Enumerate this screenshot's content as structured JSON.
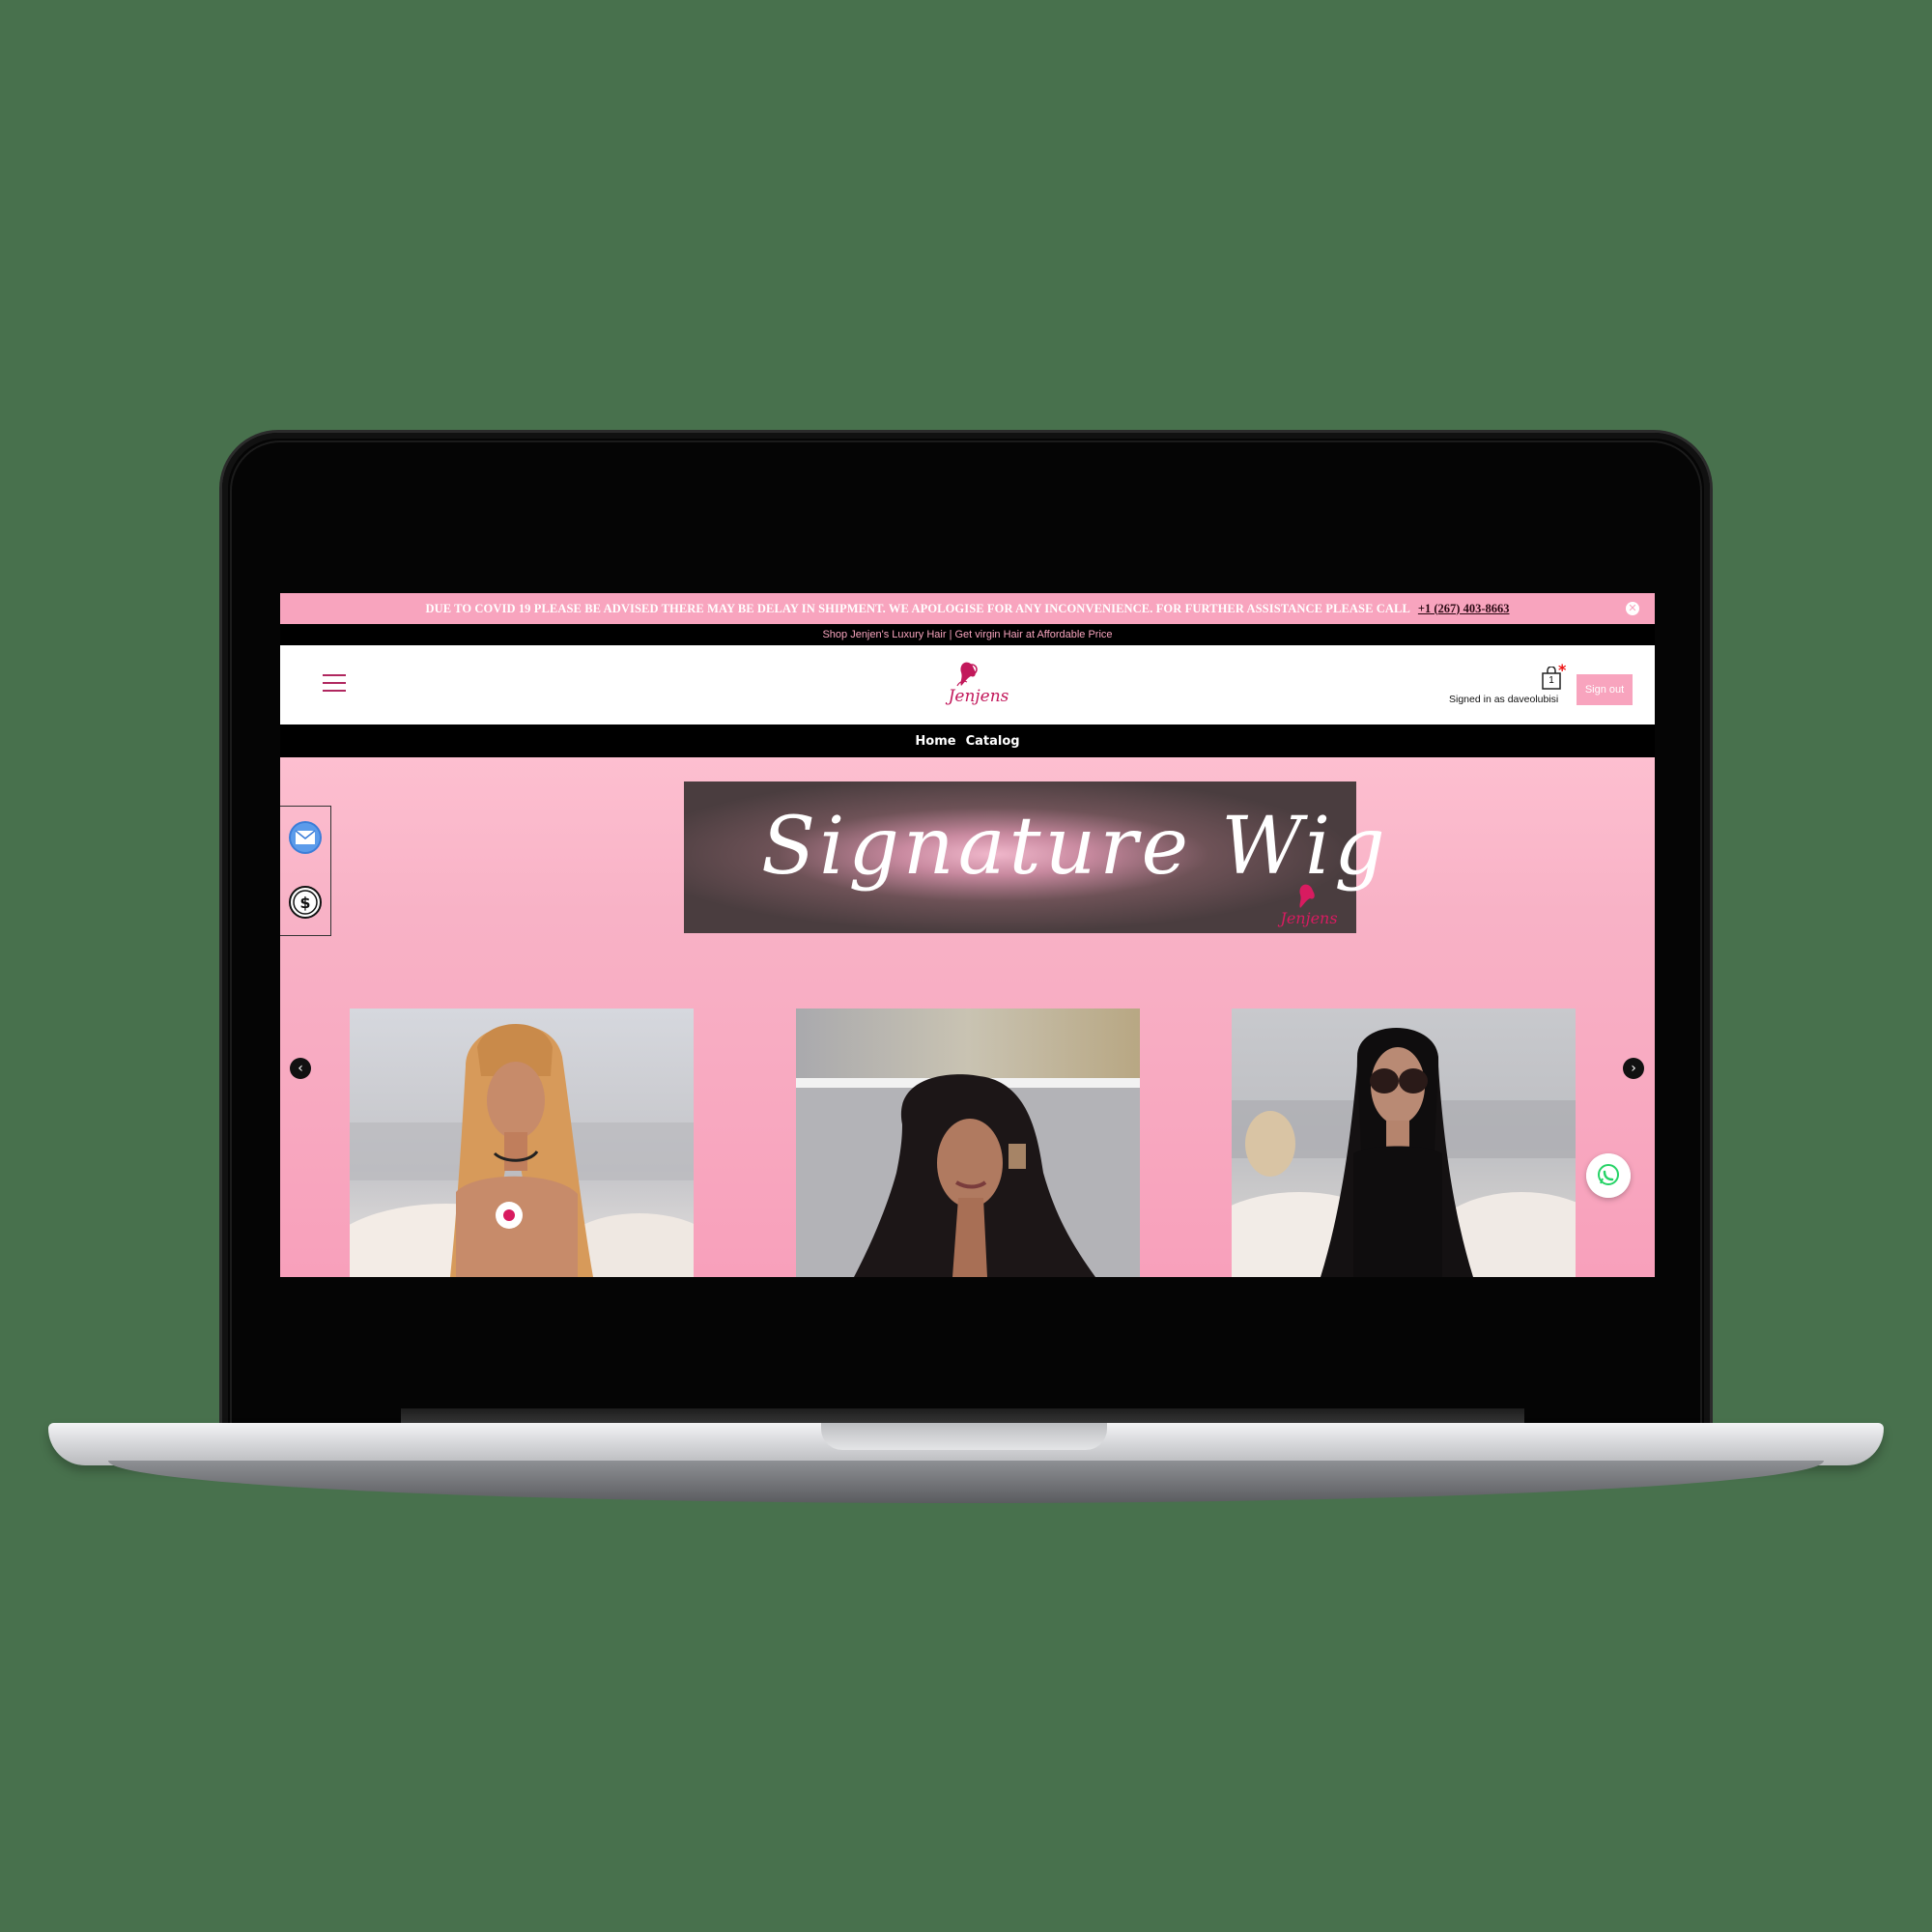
{
  "announcement": {
    "text": "DUE TO COVID 19 PLEASE BE ADVISED THERE MAY BE DELAY IN SHIPMENT. WE APOLOGISE FOR ANY INCONVENIENCE. FOR FURTHER ASSISTANCE PLEASE CALL",
    "phone": "+1 (267) 403-8663",
    "close_icon": "close-icon"
  },
  "promo": {
    "text": "Shop Jenjen's Luxury Hair | Get virgin Hair at Affordable Price"
  },
  "header": {
    "menu_icon": "hamburger-icon",
    "logo_text": "Jenjens",
    "cart_count": "1",
    "signed_in_text": "Signed in as daveolubisi",
    "sign_out_label": "Sign out"
  },
  "nav": {
    "items": [
      {
        "label": "Home"
      },
      {
        "label": "Catalog"
      }
    ]
  },
  "hero": {
    "banner_text": "Signature Wig",
    "banner_logo_text": "Jenjens"
  },
  "side_panel": {
    "icons": [
      "mail-icon",
      "dollar-icon"
    ]
  },
  "carousel": {
    "prev_icon": "chevron-left-icon",
    "next_icon": "chevron-right-icon",
    "products": [
      {
        "name": "honey-blonde-straight-wig"
      },
      {
        "name": "black-body-wave-wig"
      },
      {
        "name": "black-straight-wig"
      }
    ]
  },
  "whatsapp": {
    "icon": "whatsapp-icon"
  },
  "colors": {
    "brand_pink": "#f8a4be",
    "logo_magenta": "#c2185b",
    "background": "#48714d"
  }
}
